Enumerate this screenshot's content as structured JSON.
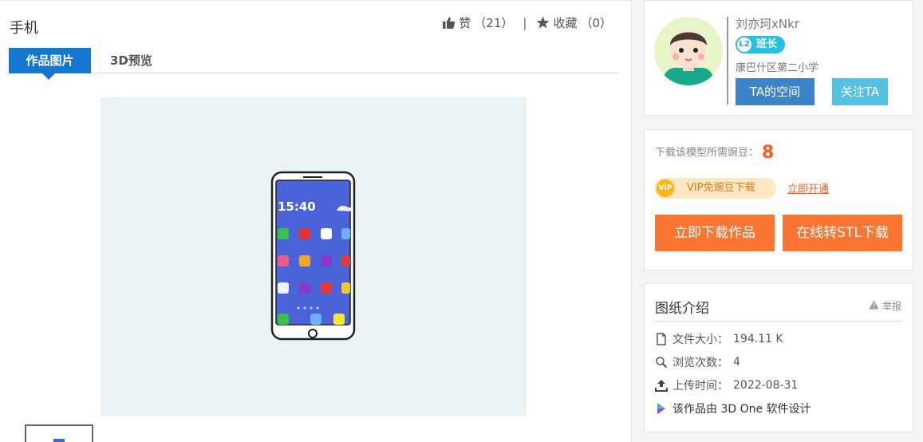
{
  "page": {
    "title": "手机",
    "likes_label": "赞",
    "likes_count": "（21）",
    "separator": "|",
    "fav_label": "收藏",
    "fav_count": "（0）"
  },
  "tabs": [
    {
      "label": "作品图片",
      "active": true
    },
    {
      "label": "3D预览",
      "active": false
    }
  ],
  "user": {
    "name": "刘亦珂xNkr",
    "level_badge": "L2",
    "role": "班长",
    "school": "康巴什区第二小学",
    "space_button": "TA的空间",
    "follow_button": "关注TA"
  },
  "download": {
    "need_label": "下载该模型所需豌豆：",
    "need_value": "8",
    "vip_icon": "VIP",
    "vip_label": "VIP免豌豆下载",
    "open_link": "立即开通",
    "download_button": "立即下载作品",
    "stl_button": "在线转STL下载"
  },
  "info": {
    "title": "图纸介绍",
    "report": "举报",
    "file_size_label": "文件大小：",
    "file_size_value": "194.11 K",
    "views_label": "浏览次数：",
    "views_value": "4",
    "upload_label": "上传时间：",
    "upload_value": "2022-08-31",
    "designed_with": "该作品由 3D One 软件设计"
  },
  "phone_screen": {
    "time": "15:40"
  },
  "colors": {
    "tab_active": "#1677d2",
    "orange": "#f97531",
    "badge": "#22c0e8",
    "space_btn": "#3d84c6",
    "follow_btn": "#56c0e0"
  }
}
